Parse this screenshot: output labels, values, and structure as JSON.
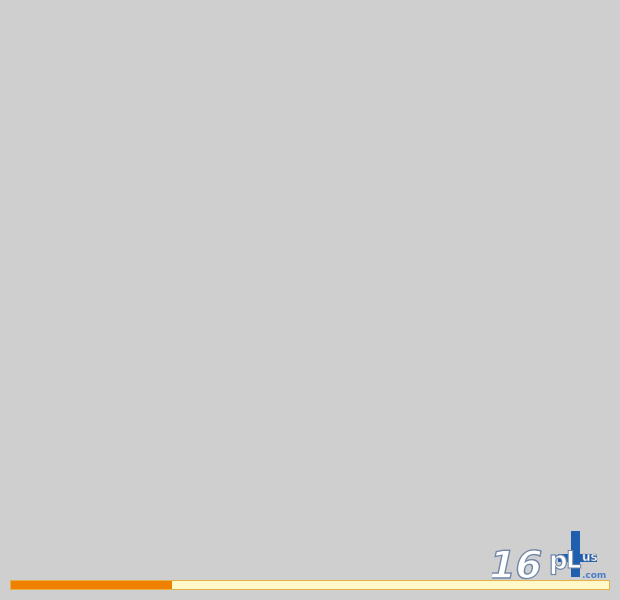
{
  "loader": {
    "progress": 0.27,
    "colors": {
      "background": "#cfcfcf",
      "progress_track": "#fff8c8",
      "progress_fill": "#f08000",
      "progress_border": "#e6b04a"
    }
  },
  "brand": {
    "logo_icon": "16plus-logo",
    "logo_text": "16pLus.com"
  }
}
